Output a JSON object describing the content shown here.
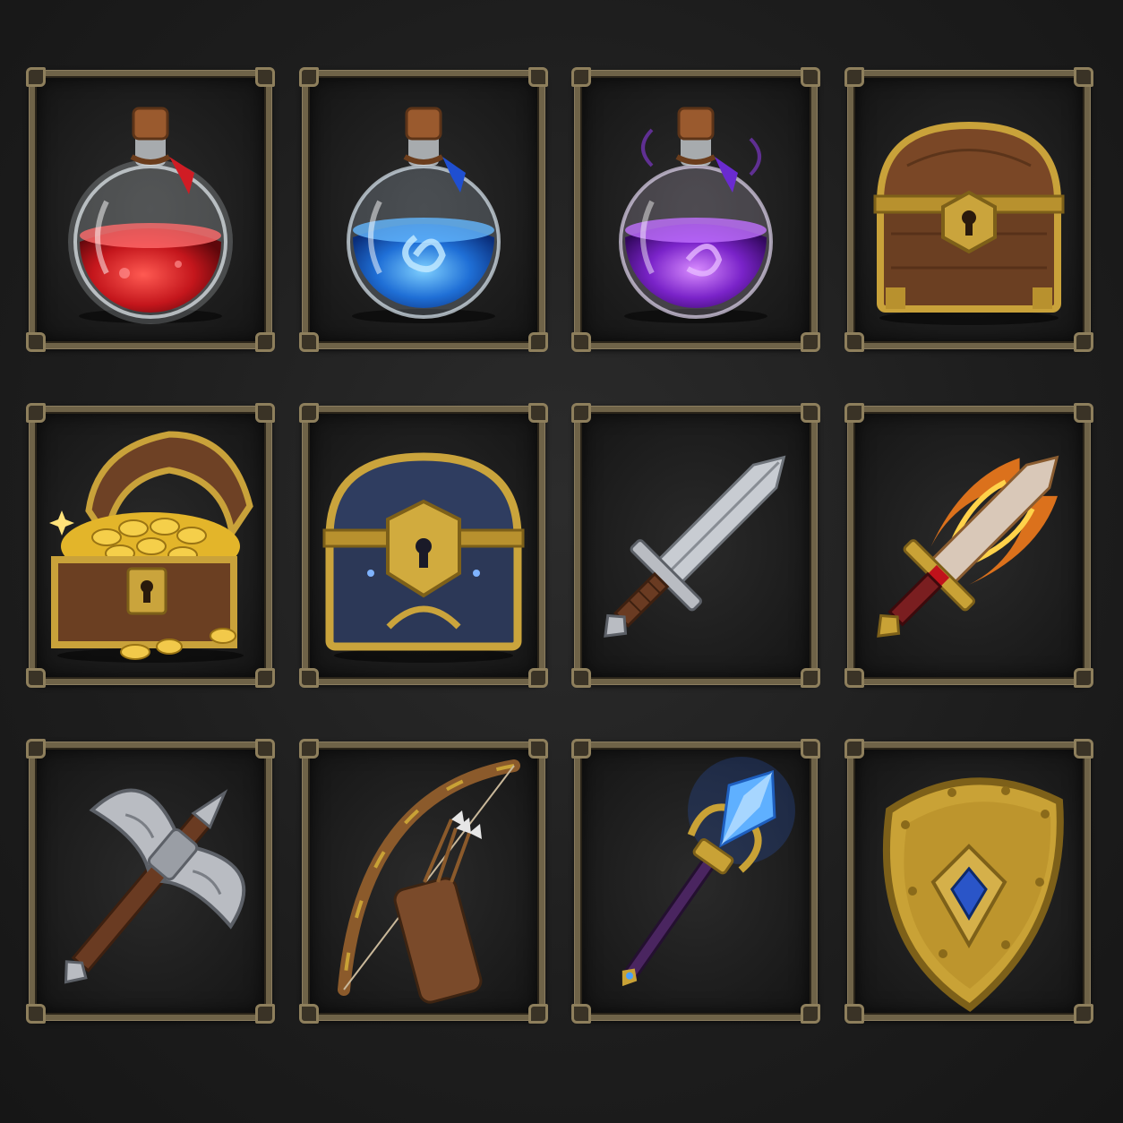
{
  "inventory": {
    "slots": [
      {
        "item": "red-health-potion",
        "icon": "red-potion-icon",
        "accent": "#d8252b"
      },
      {
        "item": "blue-mana-potion",
        "icon": "blue-potion-icon",
        "accent": "#2a7de0"
      },
      {
        "item": "purple-magic-potion",
        "icon": "purple-potion-icon",
        "accent": "#8a35d8"
      },
      {
        "item": "wooden-chest-closed",
        "icon": "treasure-chest-icon",
        "accent": "#c49a2c"
      },
      {
        "item": "gold-treasure-chest",
        "icon": "gold-chest-icon",
        "accent": "#e6b52a"
      },
      {
        "item": "blue-ornate-chest",
        "icon": "blue-chest-icon",
        "accent": "#2d3a5c"
      },
      {
        "item": "steel-sword",
        "icon": "sword-icon",
        "accent": "#b9bcc2"
      },
      {
        "item": "flaming-sword",
        "icon": "fire-sword-icon",
        "accent": "#f07a1c"
      },
      {
        "item": "battle-axe",
        "icon": "battle-axe-icon",
        "accent": "#a6a9ae"
      },
      {
        "item": "bow-and-quiver",
        "icon": "bow-icon",
        "accent": "#8b5a2b"
      },
      {
        "item": "crystal-staff",
        "icon": "crystal-staff-icon",
        "accent": "#3b8cff"
      },
      {
        "item": "golden-shield",
        "icon": "shield-icon",
        "accent": "#c9a236"
      }
    ]
  }
}
